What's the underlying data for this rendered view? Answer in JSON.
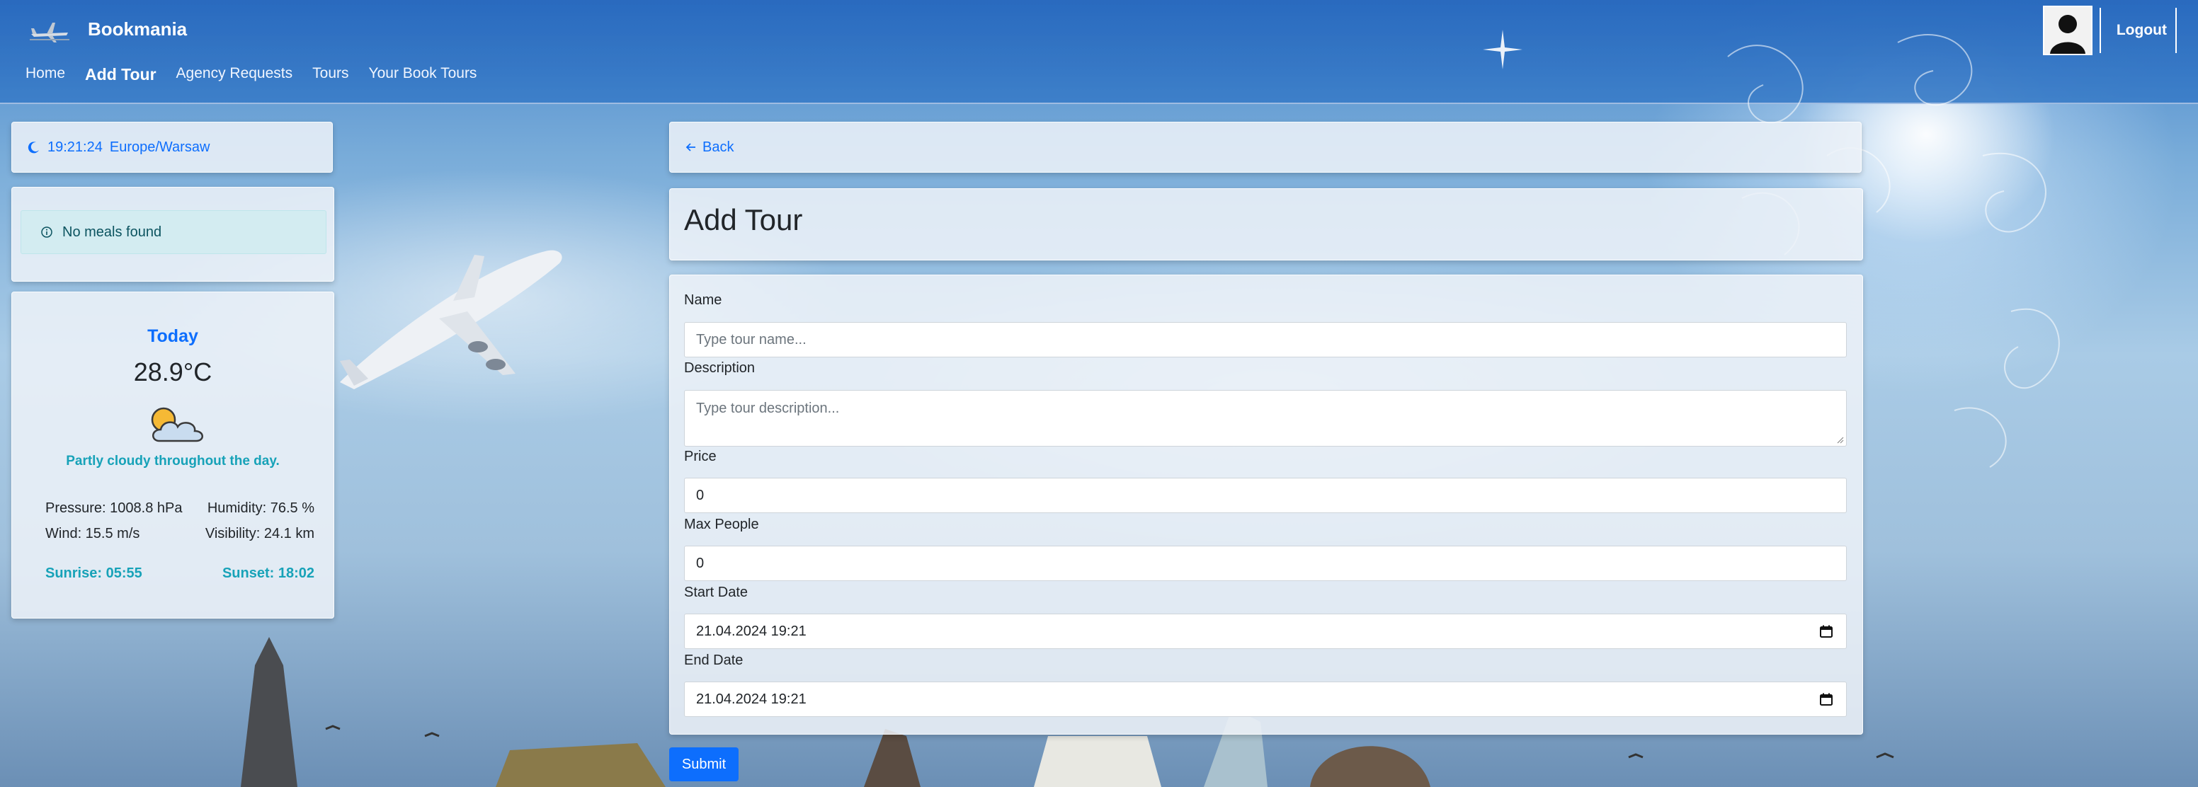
{
  "brand": {
    "name": "Bookmania"
  },
  "nav": {
    "links": [
      "Home",
      "Add Tour",
      "Agency Requests",
      "Tours",
      "Your Book Tours"
    ],
    "active_index": 1,
    "logout_label": "Logout"
  },
  "clock": {
    "time": "19:21:24",
    "timezone": "Europe/Warsaw"
  },
  "meals": {
    "alert_text": "No meals found"
  },
  "weather": {
    "day_label": "Today",
    "temperature": "28.9°C",
    "description": "Partly cloudy throughout the day.",
    "pressure": "Pressure: 1008.8 hPa",
    "humidity": "Humidity: 76.5 %",
    "wind": "Wind: 15.5 m/s",
    "visibility": "Visibility: 24.1 km",
    "sunrise": "Sunrise: 05:55",
    "sunset": "Sunset: 18:02"
  },
  "back": {
    "label": "Back"
  },
  "page": {
    "title": "Add Tour"
  },
  "form": {
    "name_label": "Name",
    "name_placeholder": "Type tour name...",
    "description_label": "Description",
    "description_placeholder": "Type tour description...",
    "price_label": "Price",
    "price_value": "0",
    "max_people_label": "Max People",
    "max_people_value": "0",
    "start_date_label": "Start Date",
    "start_date_value": "21.04.2024 19:21",
    "end_date_label": "End Date",
    "end_date_value": "21.04.2024 19:21",
    "submit_label": "Submit"
  },
  "colors": {
    "navbar": "#2c6fc2",
    "link_blue": "#0d6efd",
    "info_teal": "#17a2b8",
    "alert_bg": "#d3ecf1",
    "submit_bg": "#0d6efd"
  },
  "icons": {
    "clock": "moon-icon",
    "alert": "info-circle-icon",
    "weather": "partly-cloudy-icon",
    "back": "arrow-left-icon",
    "date": "calendar-icon"
  }
}
